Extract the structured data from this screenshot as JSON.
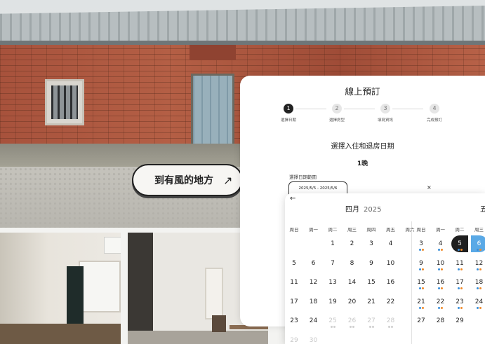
{
  "hero": {
    "tagline": "到有風的地方",
    "tagline_arrow": "↗"
  },
  "booking": {
    "title": "線上預訂",
    "steps": [
      {
        "number": "1",
        "label": "選擇日期",
        "active": true
      },
      {
        "number": "2",
        "label": "選擇房型",
        "active": false
      },
      {
        "number": "3",
        "label": "填寫資訊",
        "active": false
      },
      {
        "number": "4",
        "label": "完成預訂",
        "active": false
      }
    ],
    "subtitle": "選擇入住和退房日期",
    "nights": "1晚",
    "range_label": "選擇日期範圍",
    "range_value": "2025/5/5 - 2025/5/6",
    "clear_icon": "×"
  },
  "calendar": {
    "back_icon": "←",
    "month1": {
      "name": "四月",
      "year": "2025"
    },
    "month2_partial": "五",
    "weekdays": [
      "周日",
      "周一",
      "周二",
      "周三",
      "周四",
      "周五",
      "周六"
    ],
    "weekdays2": [
      "周日",
      "周一",
      "周二",
      "周三"
    ],
    "april": [
      [
        "",
        "",
        "1",
        "2",
        "3",
        "4"
      ],
      [
        "5",
        "6",
        "7",
        "8",
        "9",
        "10"
      ],
      [
        "11",
        "12",
        "13",
        "14",
        "15",
        "16"
      ],
      [
        "17",
        "18",
        "19",
        "20",
        "21",
        "22"
      ],
      [
        "23",
        "24",
        "25",
        "26",
        "27",
        "28"
      ],
      [
        "29",
        "30"
      ]
    ],
    "may": [
      [
        "3",
        "4",
        "5",
        "6"
      ],
      [
        "9",
        "10",
        "11",
        "12"
      ],
      [
        "15",
        "16",
        "17",
        "18"
      ],
      [
        "21",
        "22",
        "23",
        "24"
      ],
      [
        "27",
        "28",
        "29"
      ]
    ],
    "selected": {
      "start": "5",
      "end": "6"
    },
    "colors": {
      "selected_start": "#1f1f1f",
      "selected_end": "#5aa9e6",
      "dot_blue": "#3b8fd9",
      "dot_orange": "#f08a2a"
    }
  }
}
